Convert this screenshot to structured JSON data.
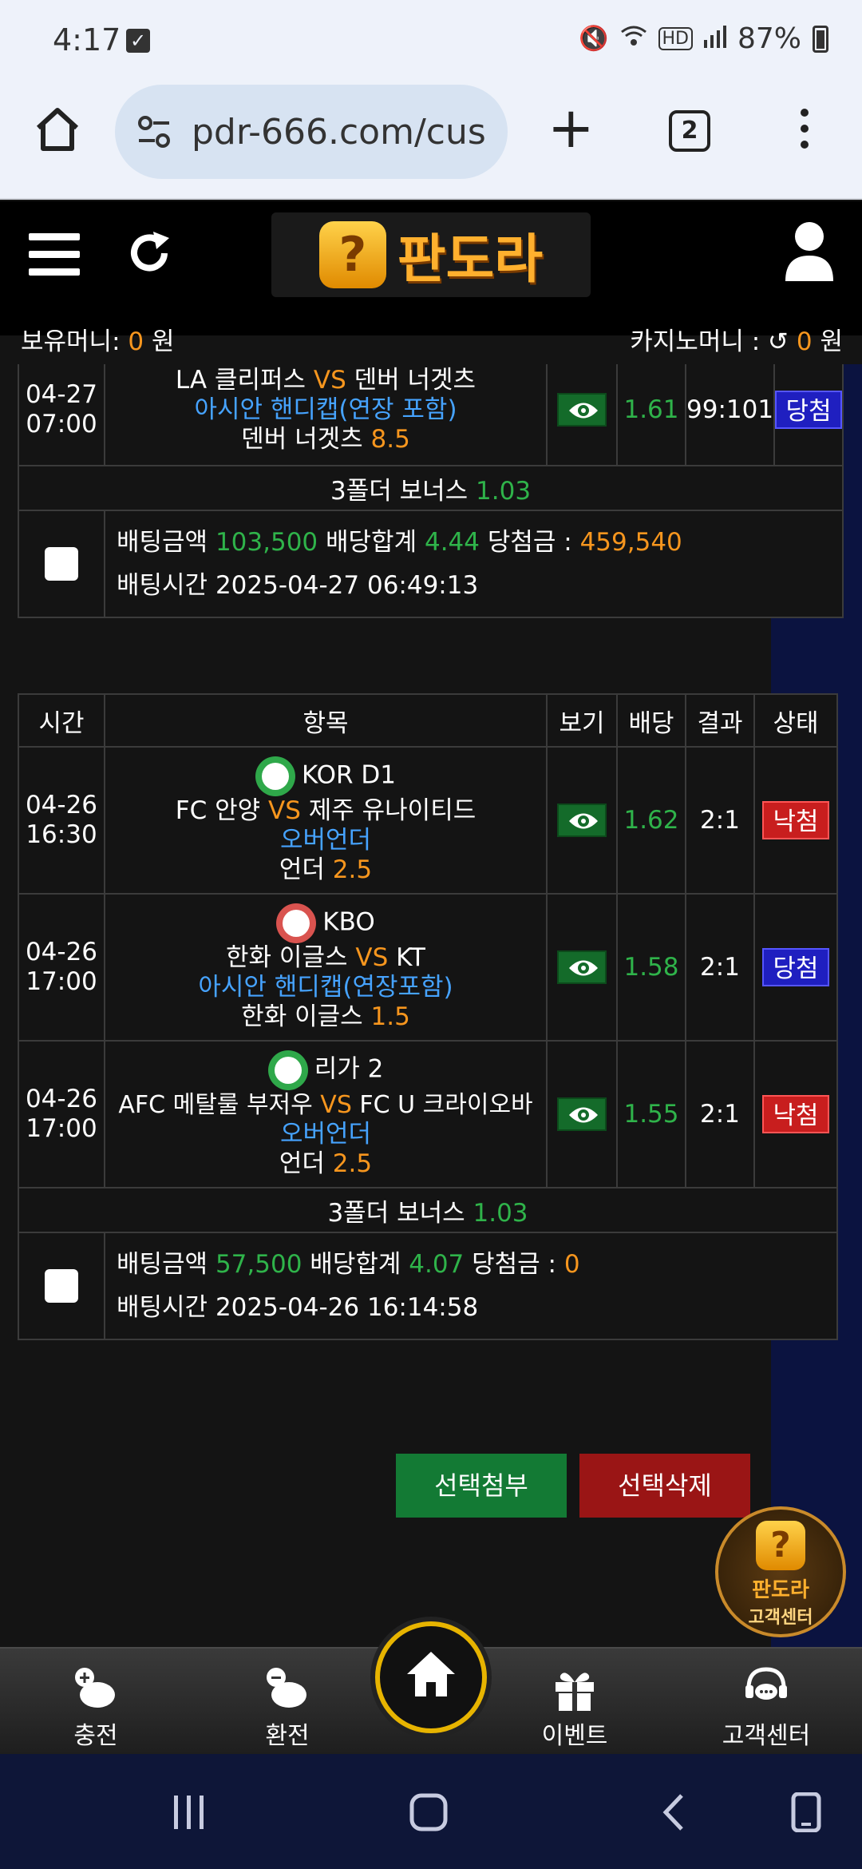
{
  "status": {
    "time": "4:17",
    "battery": "87%"
  },
  "browser": {
    "url": "pdr-666.com/cus",
    "tab_count": "2"
  },
  "site": {
    "logo_text": "판도라",
    "money": {
      "label": "보유머니:",
      "value": "0",
      "unit": "원"
    },
    "casino": {
      "label": "카지노머니 :",
      "value": "0",
      "unit": "원"
    }
  },
  "bet1": {
    "time_date": "04-27",
    "time_clock": "07:00",
    "home": "LA 클리퍼스",
    "vs": "VS",
    "away": "덴버 너겟츠",
    "market": "아시안 핸디캡(연장 포함)",
    "pick": "덴버 너겟츠",
    "pick_line": "8.5",
    "odds": "1.61",
    "result": "99:101",
    "status": "당첨",
    "bonus_label": "3폴더 보너스",
    "bonus_value": "1.03",
    "amount_label": "배팅금액",
    "amount": "103,500",
    "total_label": "배당합계",
    "total": "4.44",
    "payout_label": "당첨금 :",
    "payout": "459,540",
    "bet_time_label": "배팅시간",
    "bet_time": "2025-04-27 06:49:13"
  },
  "table_headers": [
    "시간",
    "항목",
    "보기",
    "배당",
    "결과",
    "상태"
  ],
  "bet2": {
    "rows": [
      {
        "date": "04-26",
        "clock": "16:30",
        "league": "KOR D1",
        "home": "FC 안양",
        "vs": "VS",
        "away": "제주 유나이티드",
        "market": "오버언더",
        "pick": "언더",
        "line": "2.5",
        "odds": "1.62",
        "result": "2:1",
        "status": "낙첨"
      },
      {
        "date": "04-26",
        "clock": "17:00",
        "league": "KBO",
        "home": "한화 이글스",
        "vs": "VS",
        "away": "KT",
        "market": "아시안 핸디캡(연장포함)",
        "pick": "한화 이글스",
        "line": "1.5",
        "odds": "1.58",
        "result": "2:1",
        "status": "당첨"
      },
      {
        "date": "04-26",
        "clock": "17:00",
        "league": "리가 2",
        "home": "AFC 메탈룰 부저우",
        "vs": "VS",
        "away": "FC U 크라이오바",
        "market": "오버언더",
        "pick": "언더",
        "line": "2.5",
        "odds": "1.55",
        "result": "2:1",
        "status": "낙첨"
      }
    ],
    "bonus_label": "3폴더 보너스",
    "bonus_value": "1.03",
    "amount_label": "배팅금액",
    "amount": "57,500",
    "total_label": "배당합계",
    "total": "4.07",
    "payout_label": "당첨금 :",
    "payout": "0",
    "bet_time_label": "배팅시간",
    "bet_time": "2025-04-26 16:14:58"
  },
  "actions": {
    "attach": "선택첨부",
    "delete": "선택삭제"
  },
  "cs_float": {
    "line1": "판도라",
    "line2": "고객센터"
  },
  "bottom_nav": {
    "charge": "충전",
    "exchange": "환전",
    "event": "이벤트",
    "support": "고객센터"
  },
  "colors": {
    "win": "#1f1fc0",
    "lose": "#c81e1e",
    "accent": "#f7961e",
    "odds": "#2fb34a",
    "market": "#46a3ff"
  }
}
